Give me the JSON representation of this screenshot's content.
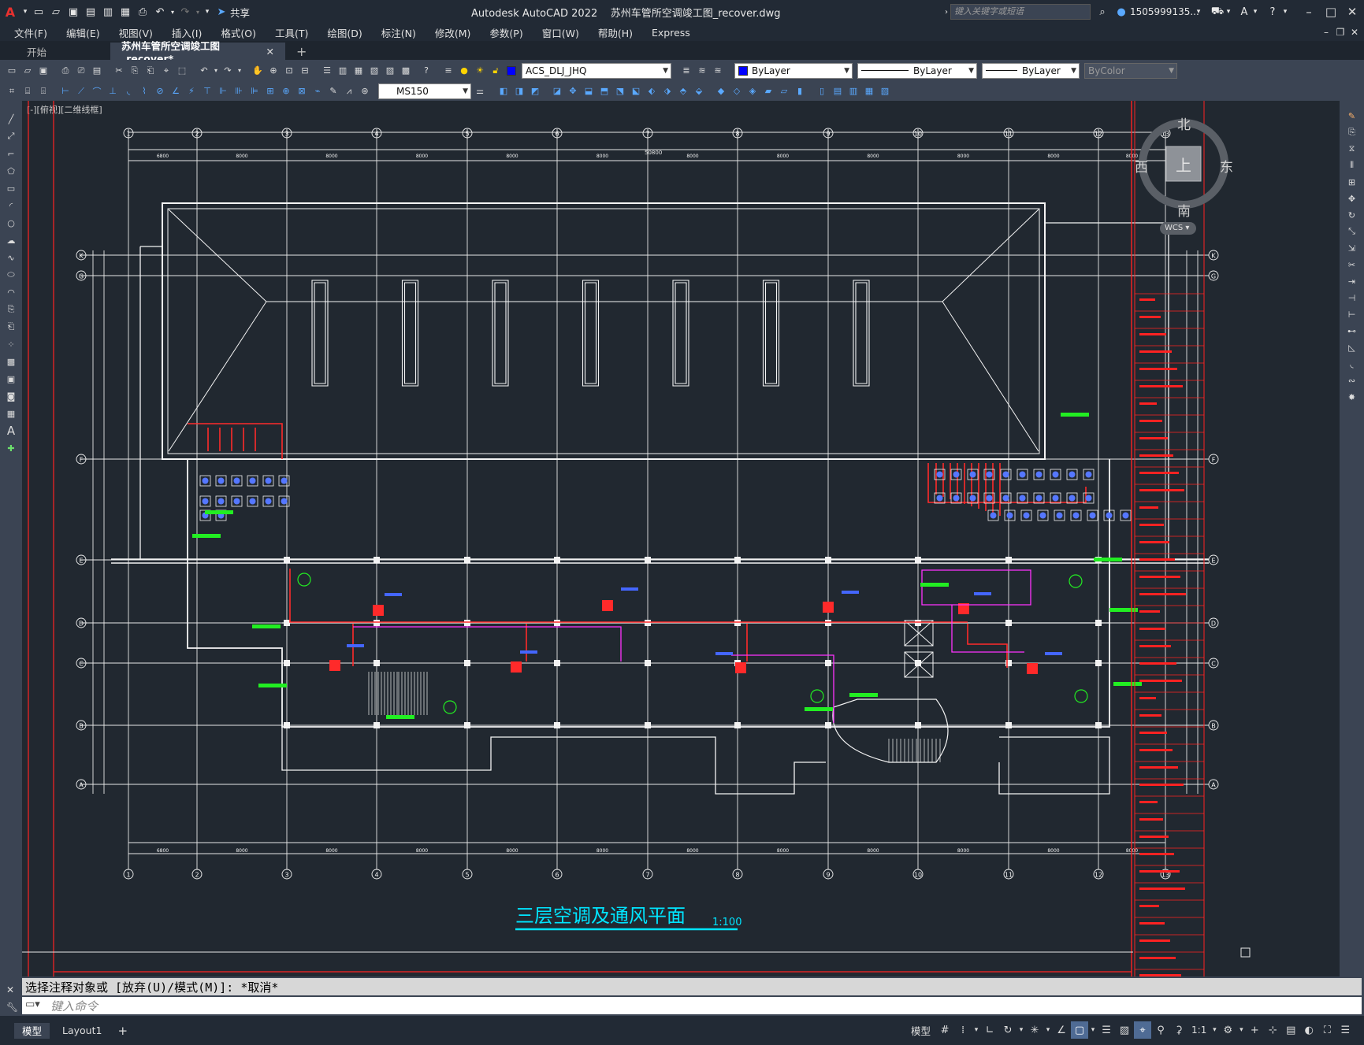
{
  "titlebar": {
    "logo": "A",
    "share_label": "共享",
    "app_title": "Autodesk AutoCAD 2022    苏州车管所空调竣工图_recover.dwg",
    "search_placeholder": "键入关键字或短语",
    "user": "1505999135...",
    "icons": [
      "new-icon",
      "open-icon",
      "save-icon",
      "saveas-icon",
      "publish-icon",
      "plot-icon",
      "undo-icon",
      "redo-icon",
      "share-icon",
      "search-icon",
      "user-icon",
      "cart-icon",
      "help-icon"
    ]
  },
  "menubar": [
    "文件(F)",
    "编辑(E)",
    "视图(V)",
    "插入(I)",
    "格式(O)",
    "工具(T)",
    "绘图(D)",
    "标注(N)",
    "修改(M)",
    "参数(P)",
    "窗口(W)",
    "帮助(H)",
    "Express"
  ],
  "tabs": [
    {
      "label": "开始",
      "active": false
    },
    {
      "label": "苏州车管所空调竣工图_recover*",
      "active": true
    }
  ],
  "toolbar1": {
    "layer": "ACS_DLJ_JHQ",
    "color": "ByLayer",
    "linetype": "ByLayer",
    "lineweight": "ByLayer",
    "plotstyle": "ByColor",
    "layer_color": "#0000ff"
  },
  "toolbar2": {
    "textstyle": "MS150"
  },
  "viewport_label": "[-][俯视][二维线框]",
  "viewcube": {
    "top": "上",
    "north": "北",
    "south": "南",
    "east": "东",
    "west": "西",
    "ucs": "WCS"
  },
  "drawing": {
    "title": "三层空调及通风平面",
    "scale": "1:100",
    "grid_top": [
      "1",
      "2",
      "3",
      "4",
      "5",
      "6",
      "7",
      "8",
      "9",
      "10",
      "11",
      "12",
      "13"
    ],
    "grid_left": [
      "K",
      "G",
      "F",
      "E",
      "D",
      "C",
      "B",
      "A"
    ],
    "overall_dim": "50800",
    "bay_dims": [
      "6800",
      "8000",
      "8000",
      "8000",
      "8000",
      "8000",
      "8000",
      "8000",
      "8000",
      "8000",
      "8000",
      "8000"
    ],
    "colors": {
      "lines": "#f2f2f2",
      "equipment": "#ff2a2a",
      "labels": "#22ee22",
      "pipes": "#ff33ff",
      "tags": "#4466ff",
      "title": "#00e5ff"
    }
  },
  "command": {
    "prompt": "选择注释对象或 [放弃(U)/模式(M)]: *取消*",
    "placeholder": "键入命令"
  },
  "statusbar": {
    "tabs": [
      "模型",
      "Layout1"
    ],
    "model_label": "模型",
    "scale": "1:1"
  }
}
